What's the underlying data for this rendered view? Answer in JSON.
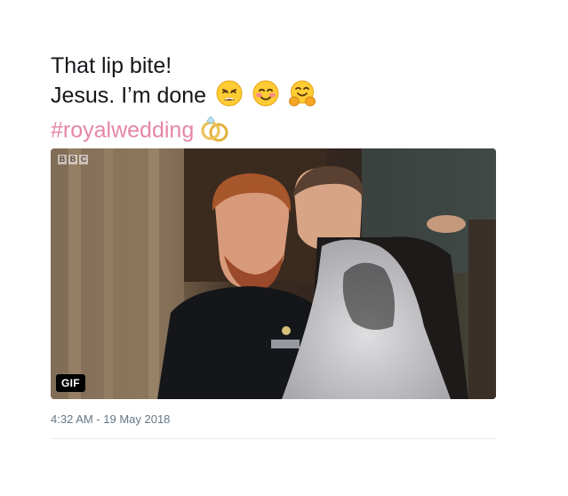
{
  "tweet": {
    "line1": "That lip bite!",
    "line2": "Jesus. I’m done",
    "hashtag": "#royalwedding",
    "emojis": [
      "weary-face-icon",
      "smiling-face-blush-icon",
      "hugging-face-icon"
    ],
    "ring_emoji": "rings-icon",
    "hashtag_color": "#e586a6"
  },
  "media": {
    "watermark": [
      "B",
      "B",
      "C"
    ],
    "badge": "GIF"
  },
  "timestamp": "4:32 AM - 19 May 2018"
}
